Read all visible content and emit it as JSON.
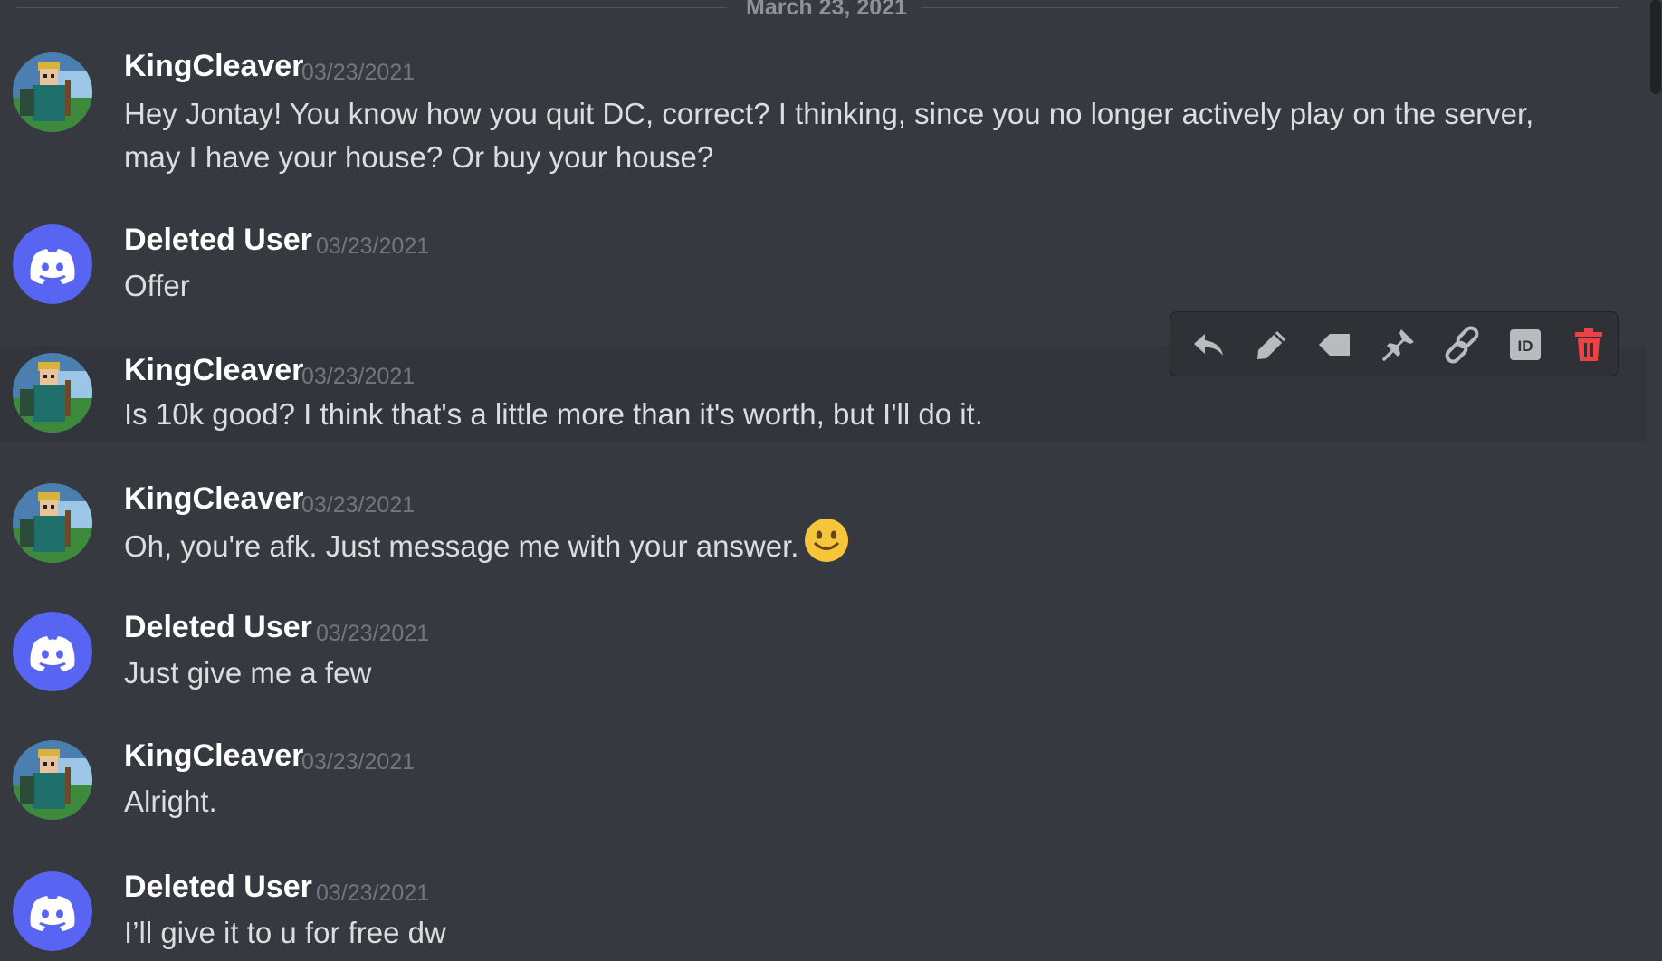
{
  "date_divider": "March 23, 2021",
  "messages": [
    {
      "author": "KingCleaver",
      "avatar": "knight-avatar",
      "timestamp": "03/23/2021",
      "lines": [
        "Hey Jontay! You know how you quit DC, correct? I thinking, since you no longer actively play on the server,",
        "may I have your house? Or buy your house?"
      ]
    },
    {
      "author": "Deleted User",
      "avatar": "discord-avatar",
      "timestamp": "03/23/2021",
      "lines": [
        "Offer"
      ]
    },
    {
      "author": "KingCleaver",
      "avatar": "knight-avatar",
      "timestamp": "03/23/2021",
      "lines": [
        "Is 10k good? I think that's a little more than it's worth, but I'll do it."
      ]
    },
    {
      "author": "KingCleaver",
      "avatar": "knight-avatar",
      "timestamp": "03/23/2021",
      "lines": [
        "Oh, you're afk. Just message me with your answer."
      ],
      "emoji": "slightly-smiling-face"
    },
    {
      "author": "Deleted User",
      "avatar": "discord-avatar",
      "timestamp": "03/23/2021",
      "lines": [
        "Just give me a few"
      ]
    },
    {
      "author": "KingCleaver",
      "avatar": "knight-avatar",
      "timestamp": "03/23/2021",
      "lines": [
        "Alright."
      ]
    },
    {
      "author": "Deleted User",
      "avatar": "discord-avatar",
      "timestamp": "03/23/2021",
      "lines": [
        "I’ll give it to u for free dw"
      ]
    }
  ],
  "toolbar": {
    "icons": [
      "reply-icon",
      "edit-icon",
      "tag-icon",
      "pin-icon",
      "link-icon",
      "id-icon",
      "trash-icon"
    ],
    "delete_color": "#ed4245"
  },
  "colors": {
    "background": "#36393f",
    "hover_background": "#32353b",
    "discord_blurple": "#5865f2",
    "author": "#ffffff",
    "text": "#dcddde",
    "timestamp": "#72767d"
  }
}
